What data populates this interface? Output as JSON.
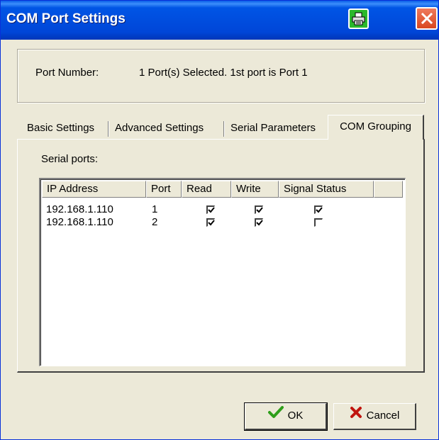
{
  "window": {
    "title": "COM Port Settings",
    "print_icon": "printer-icon",
    "close_icon": "close-icon"
  },
  "port": {
    "label": "Port Number:",
    "value": "1 Port(s) Selected. 1st port is Port 1"
  },
  "tabs": [
    {
      "label": "Basic Settings",
      "active": false
    },
    {
      "label": "Advanced Settings",
      "active": false
    },
    {
      "label": "Serial Parameters",
      "active": false
    },
    {
      "label": "COM Grouping",
      "active": true
    }
  ],
  "panel": {
    "serial_label": "Serial ports:",
    "columns": [
      "IP Address",
      "Port",
      "Read",
      "Write",
      "Signal Status"
    ],
    "rows": [
      {
        "ip": "192.168.1.110",
        "port": "1",
        "read": true,
        "write": true,
        "signal": true
      },
      {
        "ip": "192.168.1.110",
        "port": "2",
        "read": true,
        "write": true,
        "signal": false
      }
    ]
  },
  "buttons": {
    "ok": "OK",
    "cancel": "Cancel"
  },
  "colors": {
    "titlebar": "#0046d8",
    "dialog": "#ece9d8",
    "ok_check": "#2e9e1a",
    "cancel_x": "#c0150f"
  }
}
